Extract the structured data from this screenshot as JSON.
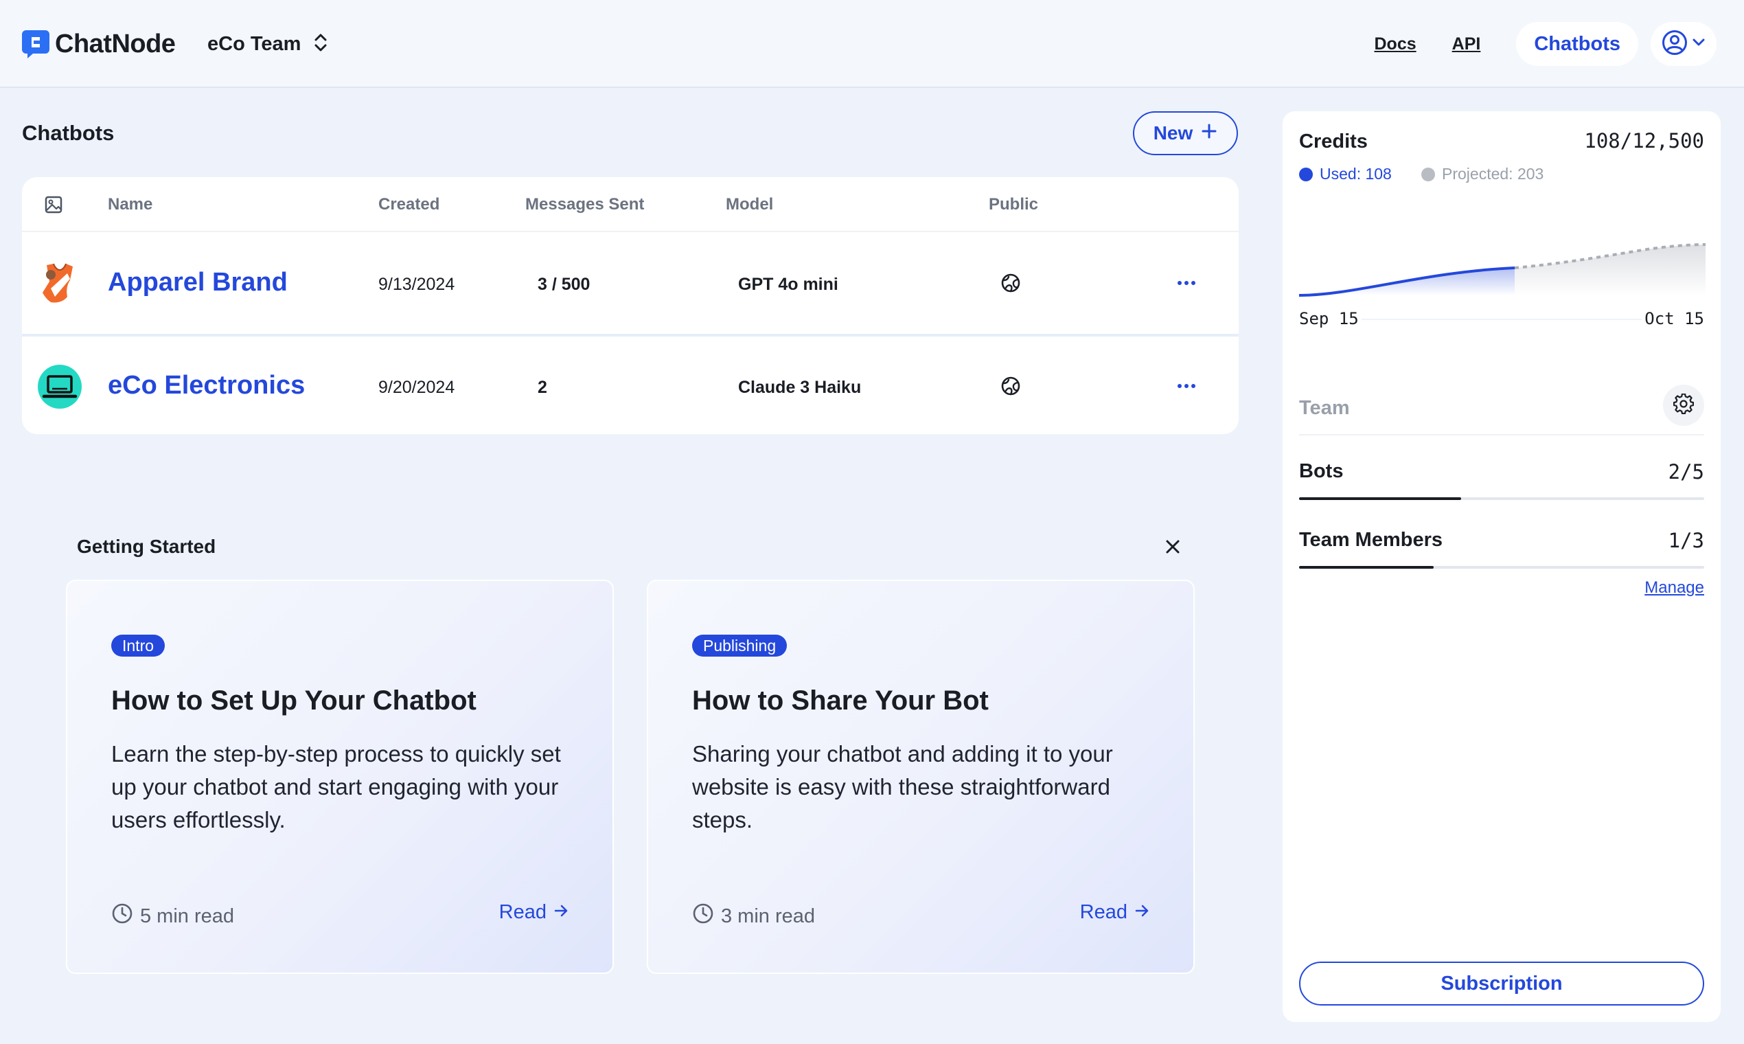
{
  "header": {
    "logo_text": "ChatNode",
    "team_name": "eCo Team",
    "nav": {
      "docs": "Docs",
      "api": "API",
      "chatbots": "Chatbots"
    }
  },
  "chatbots": {
    "title": "Chatbots",
    "new_button": "New",
    "columns": {
      "image": "image-icon",
      "name": "Name",
      "created": "Created",
      "messages": "Messages Sent",
      "model": "Model",
      "public": "Public"
    },
    "rows": [
      {
        "name": "Apparel Brand",
        "created": "9/13/2024",
        "messages": "3 / 500",
        "model": "GPT 4o mini",
        "avatar": "shirt-avatar",
        "public_icon": "globe-icon"
      },
      {
        "name": "eCo Electronics",
        "created": "9/20/2024",
        "messages": "2",
        "model": "Claude 3 Haiku",
        "avatar": "laptop-avatar",
        "public_icon": "globe-icon"
      }
    ]
  },
  "getting_started": {
    "title": "Getting Started",
    "cards": [
      {
        "tag": "Intro",
        "title": "How to Set Up Your Chatbot",
        "description": "Learn the step-by-step process to quickly set up your chatbot and start engaging with your users effortlessly.",
        "read_time": "5 min read",
        "read_label": "Read"
      },
      {
        "tag": "Publishing",
        "title": "How to Share Your Bot",
        "description": "Sharing your chatbot and adding it to your website is easy with these straightforward steps.",
        "read_time": "3 min read",
        "read_label": "Read"
      }
    ]
  },
  "panel": {
    "credits": {
      "title": "Credits",
      "value": "108/12,500",
      "used_label": "Used: 108",
      "projected_label": "Projected: 203",
      "used_color": "#2448db",
      "projected_color": "#b9bcc3",
      "start_label": "Sep 15",
      "end_label": "Oct 15"
    },
    "team": {
      "label": "Team",
      "bots_label": "Bots",
      "bots_value": "2/5",
      "bots_fraction": 0.4,
      "members_label": "Team Members",
      "members_value": "1/3",
      "members_fraction": 0.333,
      "manage_label": "Manage"
    },
    "subscription_label": "Subscription"
  }
}
